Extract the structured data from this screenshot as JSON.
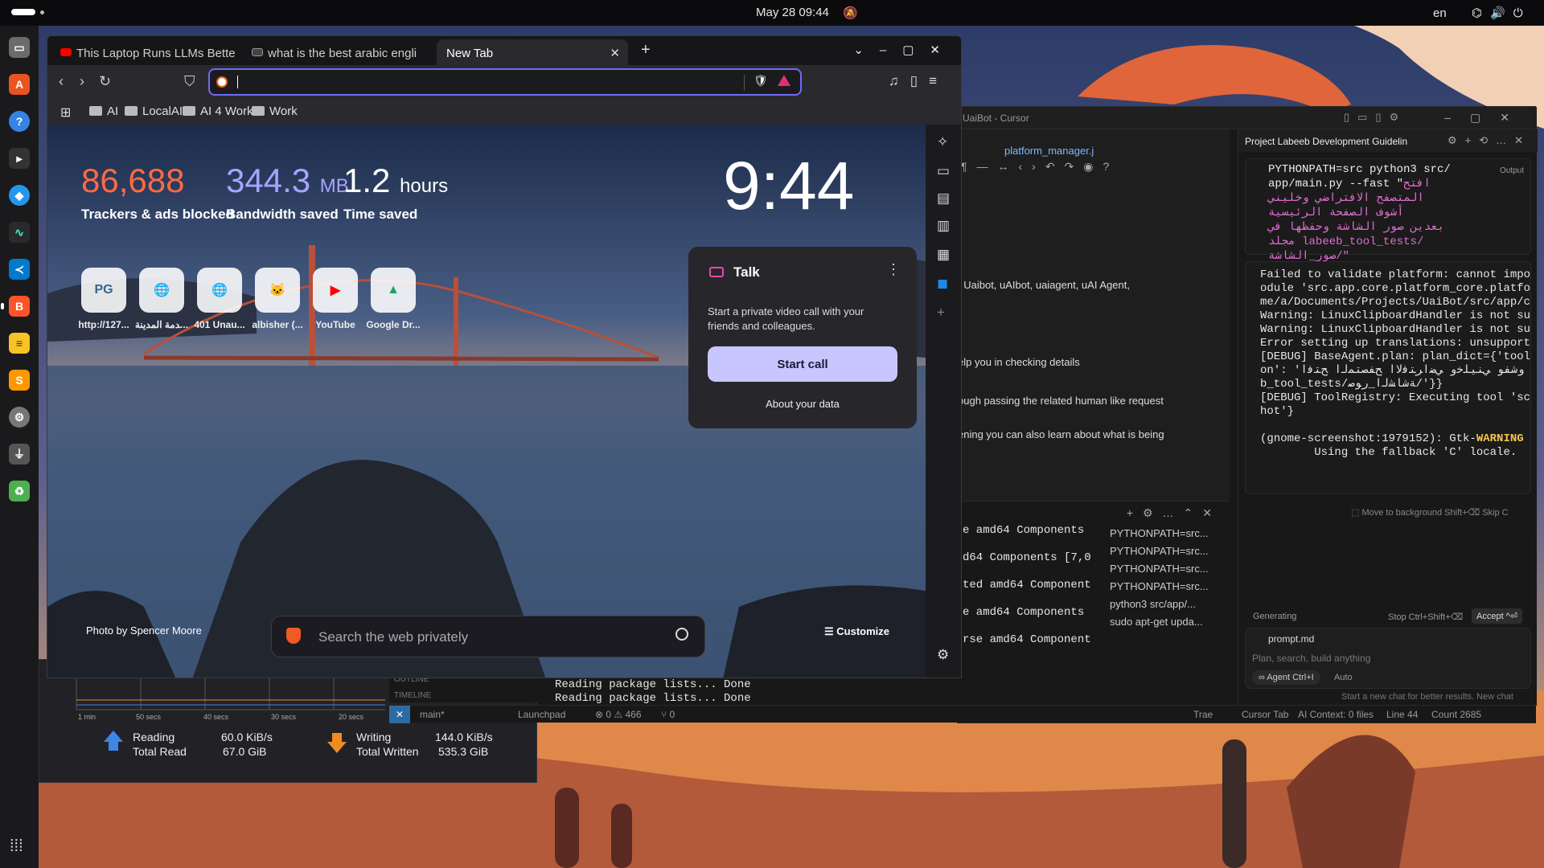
{
  "topbar": {
    "datetime": "May 28  09:44",
    "language": "en"
  },
  "brave": {
    "tabs": [
      {
        "title": "This Laptop Runs LLMs Bette"
      },
      {
        "title": "what is the best arabic engli"
      },
      {
        "title": "New Tab"
      }
    ],
    "url_value": "",
    "bookmarks": [
      "AI",
      "LocalAI",
      "AI 4 Work",
      "Work"
    ],
    "stats": {
      "trackers_value": "86,688",
      "trackers_label": "Trackers & ads blocked",
      "bandwidth_value": "344.3",
      "bandwidth_unit": "MB",
      "bandwidth_label": "Bandwidth saved",
      "time_value": "1.2",
      "time_unit": "hours",
      "time_label": "Time saved"
    },
    "clock": "9:44",
    "top_sites": [
      {
        "label": "http://127...",
        "glyph": "PG"
      },
      {
        "label": "ﺪﻣﺔ ﺍﻟﻤﺪﻳﻨﺔ...",
        "glyph": "🌐"
      },
      {
        "label": "401 Unau...",
        "glyph": "🌐"
      },
      {
        "label": "albisher (...",
        "glyph": "🐱"
      },
      {
        "label": "YouTube",
        "glyph": "▶"
      },
      {
        "label": "Google Dr...",
        "glyph": "▲"
      }
    ],
    "talk": {
      "title": "Talk",
      "description": "Start a private video call with your friends and colleagues.",
      "start_call": "Start call",
      "about": "About your data"
    },
    "photo_credit": "Photo by Spencer Moore",
    "search_placeholder": "Search the web privately",
    "customize": "Customize"
  },
  "cursor": {
    "title": "UaiBot - Cursor",
    "editor_tab": "platform_manager.j",
    "editor_lines": [
      ", Uaibot, uAIbot, uaiagent, uAI Agent,",
      "elp you in checking details",
      "ough passing the related human like request",
      "ening you can also learn about what is being"
    ],
    "terminal_lines": [
      "e amd64 Components",
      "d64 Components [7,0",
      "ted amd64 Component",
      "e amd64 Components",
      "rse amd64 Component",
      "Reading package lists... Done",
      "Reading package lists... Done"
    ],
    "terminal_list": [
      "PYTHONPATH=src...",
      "PYTHONPATH=src...",
      "PYTHONPATH=src...",
      "PYTHONPATH=src...",
      "python3 src/app/...",
      "sudo apt-get upda..."
    ],
    "outline": "OUTLINE",
    "timeline": "TIMELINE",
    "status": {
      "branch": "main*",
      "launchpad": "Launchpad",
      "problems": "⊗ 0 ⚠ 466",
      "ports": "⑂ 0",
      "trae": "Trae",
      "cursor_tab": "Cursor Tab",
      "ai_context": "AI Context: 0 files",
      "line": "Line 44",
      "count": "Count 2685"
    },
    "chat": {
      "title": "Project Labeeb Development Guidelin",
      "command": "PYTHONPATH=src python3 src/\napp/main.py --fast \"",
      "command_arabic": "افتح\nالمتصفح الافتراضي وخليني\nأشوف الصفحة الرئيسية\nبعدين صور الشاشة وحفظها في\nمجلد labeeb_tool_tests/\nصور_الشاشة/\"",
      "badge": "Output",
      "output": "Failed to validate platform: cannot impor\nodule 'src.app.core.platform_core.platfor\nme/a/Documents/Projects/UaiBot/src/app/co\nWarning: LinuxClipboardHandler is not sup\nWarning: LinuxClipboardHandler is not sup\nError setting up translations: unsupporte\n[DEBUG] BaseAgent.plan: plan_dict={'tool'\non': 'ﻭﺷﻔﻮ ﻲﻨﻴﻠﺧﻭ ﻲﺿﺍﺮﺘﻓﻻﺍ ﺢﻔﺼﺘﻤﻟﺍ ﺢﺘﻓﺍ\nb_tool_tests/ﺔﺷﺎﺸﻟﺍ_ﺭﻮﺻ/'}}\n[DEBUG] ToolRegistry: Executing tool 'scr\nhot'}\n\n(gnome-screenshot:1979152): Gtk-",
      "warning": "WARNING",
      "output_tail": " *\n        Using the fallback 'C' locale.",
      "move_bg": "⬚ Move to background     Shift+⌫ Skip C",
      "generating": "Generating",
      "stop": "Stop  Ctrl+Shift+⌫",
      "accept": "Accept ^⏎",
      "file": "prompt.md",
      "placeholder": "Plan, search, build anything",
      "agent": "∞ Agent  Ctrl+I",
      "auto": "Auto",
      "footer": "Start a new chat for better results.   New chat"
    }
  },
  "sysmon": {
    "ticks": [
      "1 min",
      "50 secs",
      "40 secs",
      "30 secs",
      "20 secs"
    ],
    "reading_label": "Reading",
    "total_read_label": "Total Read",
    "reading_rate": "60.0 KiB/s",
    "total_read": "67.0 GiB",
    "writing_label": "Writing",
    "total_written_label": "Total Written",
    "writing_rate": "144.0 KiB/s",
    "total_written": "535.3 GiB"
  }
}
